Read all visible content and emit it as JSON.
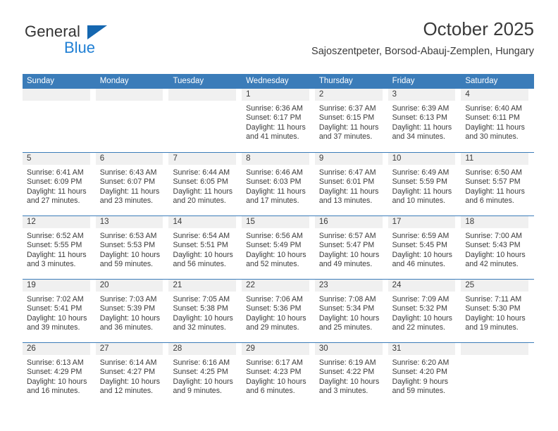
{
  "brand": {
    "word1": "General",
    "word2": "Blue",
    "accent_color": "#1f7fd4"
  },
  "header": {
    "title": "October 2025",
    "subtitle": "Sajoszentpeter, Borsod-Abauj-Zemplen, Hungary"
  },
  "theme": {
    "header_bg": "#3b7cb9",
    "daynum_bg": "#f0f0f0",
    "text": "#3a3a3a"
  },
  "weekdays": [
    "Sunday",
    "Monday",
    "Tuesday",
    "Wednesday",
    "Thursday",
    "Friday",
    "Saturday"
  ],
  "weeks": [
    [
      {
        "day": "",
        "lines": []
      },
      {
        "day": "",
        "lines": []
      },
      {
        "day": "",
        "lines": []
      },
      {
        "day": "1",
        "lines": [
          "Sunrise: 6:36 AM",
          "Sunset: 6:17 PM",
          "Daylight: 11 hours",
          "and 41 minutes."
        ]
      },
      {
        "day": "2",
        "lines": [
          "Sunrise: 6:37 AM",
          "Sunset: 6:15 PM",
          "Daylight: 11 hours",
          "and 37 minutes."
        ]
      },
      {
        "day": "3",
        "lines": [
          "Sunrise: 6:39 AM",
          "Sunset: 6:13 PM",
          "Daylight: 11 hours",
          "and 34 minutes."
        ]
      },
      {
        "day": "4",
        "lines": [
          "Sunrise: 6:40 AM",
          "Sunset: 6:11 PM",
          "Daylight: 11 hours",
          "and 30 minutes."
        ]
      }
    ],
    [
      {
        "day": "5",
        "lines": [
          "Sunrise: 6:41 AM",
          "Sunset: 6:09 PM",
          "Daylight: 11 hours",
          "and 27 minutes."
        ]
      },
      {
        "day": "6",
        "lines": [
          "Sunrise: 6:43 AM",
          "Sunset: 6:07 PM",
          "Daylight: 11 hours",
          "and 23 minutes."
        ]
      },
      {
        "day": "7",
        "lines": [
          "Sunrise: 6:44 AM",
          "Sunset: 6:05 PM",
          "Daylight: 11 hours",
          "and 20 minutes."
        ]
      },
      {
        "day": "8",
        "lines": [
          "Sunrise: 6:46 AM",
          "Sunset: 6:03 PM",
          "Daylight: 11 hours",
          "and 17 minutes."
        ]
      },
      {
        "day": "9",
        "lines": [
          "Sunrise: 6:47 AM",
          "Sunset: 6:01 PM",
          "Daylight: 11 hours",
          "and 13 minutes."
        ]
      },
      {
        "day": "10",
        "lines": [
          "Sunrise: 6:49 AM",
          "Sunset: 5:59 PM",
          "Daylight: 11 hours",
          "and 10 minutes."
        ]
      },
      {
        "day": "11",
        "lines": [
          "Sunrise: 6:50 AM",
          "Sunset: 5:57 PM",
          "Daylight: 11 hours",
          "and 6 minutes."
        ]
      }
    ],
    [
      {
        "day": "12",
        "lines": [
          "Sunrise: 6:52 AM",
          "Sunset: 5:55 PM",
          "Daylight: 11 hours",
          "and 3 minutes."
        ]
      },
      {
        "day": "13",
        "lines": [
          "Sunrise: 6:53 AM",
          "Sunset: 5:53 PM",
          "Daylight: 10 hours",
          "and 59 minutes."
        ]
      },
      {
        "day": "14",
        "lines": [
          "Sunrise: 6:54 AM",
          "Sunset: 5:51 PM",
          "Daylight: 10 hours",
          "and 56 minutes."
        ]
      },
      {
        "day": "15",
        "lines": [
          "Sunrise: 6:56 AM",
          "Sunset: 5:49 PM",
          "Daylight: 10 hours",
          "and 52 minutes."
        ]
      },
      {
        "day": "16",
        "lines": [
          "Sunrise: 6:57 AM",
          "Sunset: 5:47 PM",
          "Daylight: 10 hours",
          "and 49 minutes."
        ]
      },
      {
        "day": "17",
        "lines": [
          "Sunrise: 6:59 AM",
          "Sunset: 5:45 PM",
          "Daylight: 10 hours",
          "and 46 minutes."
        ]
      },
      {
        "day": "18",
        "lines": [
          "Sunrise: 7:00 AM",
          "Sunset: 5:43 PM",
          "Daylight: 10 hours",
          "and 42 minutes."
        ]
      }
    ],
    [
      {
        "day": "19",
        "lines": [
          "Sunrise: 7:02 AM",
          "Sunset: 5:41 PM",
          "Daylight: 10 hours",
          "and 39 minutes."
        ]
      },
      {
        "day": "20",
        "lines": [
          "Sunrise: 7:03 AM",
          "Sunset: 5:39 PM",
          "Daylight: 10 hours",
          "and 36 minutes."
        ]
      },
      {
        "day": "21",
        "lines": [
          "Sunrise: 7:05 AM",
          "Sunset: 5:38 PM",
          "Daylight: 10 hours",
          "and 32 minutes."
        ]
      },
      {
        "day": "22",
        "lines": [
          "Sunrise: 7:06 AM",
          "Sunset: 5:36 PM",
          "Daylight: 10 hours",
          "and 29 minutes."
        ]
      },
      {
        "day": "23",
        "lines": [
          "Sunrise: 7:08 AM",
          "Sunset: 5:34 PM",
          "Daylight: 10 hours",
          "and 25 minutes."
        ]
      },
      {
        "day": "24",
        "lines": [
          "Sunrise: 7:09 AM",
          "Sunset: 5:32 PM",
          "Daylight: 10 hours",
          "and 22 minutes."
        ]
      },
      {
        "day": "25",
        "lines": [
          "Sunrise: 7:11 AM",
          "Sunset: 5:30 PM",
          "Daylight: 10 hours",
          "and 19 minutes."
        ]
      }
    ],
    [
      {
        "day": "26",
        "lines": [
          "Sunrise: 6:13 AM",
          "Sunset: 4:29 PM",
          "Daylight: 10 hours",
          "and 16 minutes."
        ]
      },
      {
        "day": "27",
        "lines": [
          "Sunrise: 6:14 AM",
          "Sunset: 4:27 PM",
          "Daylight: 10 hours",
          "and 12 minutes."
        ]
      },
      {
        "day": "28",
        "lines": [
          "Sunrise: 6:16 AM",
          "Sunset: 4:25 PM",
          "Daylight: 10 hours",
          "and 9 minutes."
        ]
      },
      {
        "day": "29",
        "lines": [
          "Sunrise: 6:17 AM",
          "Sunset: 4:23 PM",
          "Daylight: 10 hours",
          "and 6 minutes."
        ]
      },
      {
        "day": "30",
        "lines": [
          "Sunrise: 6:19 AM",
          "Sunset: 4:22 PM",
          "Daylight: 10 hours",
          "and 3 minutes."
        ]
      },
      {
        "day": "31",
        "lines": [
          "Sunrise: 6:20 AM",
          "Sunset: 4:20 PM",
          "Daylight: 9 hours",
          "and 59 minutes."
        ]
      },
      {
        "day": "",
        "lines": []
      }
    ]
  ]
}
